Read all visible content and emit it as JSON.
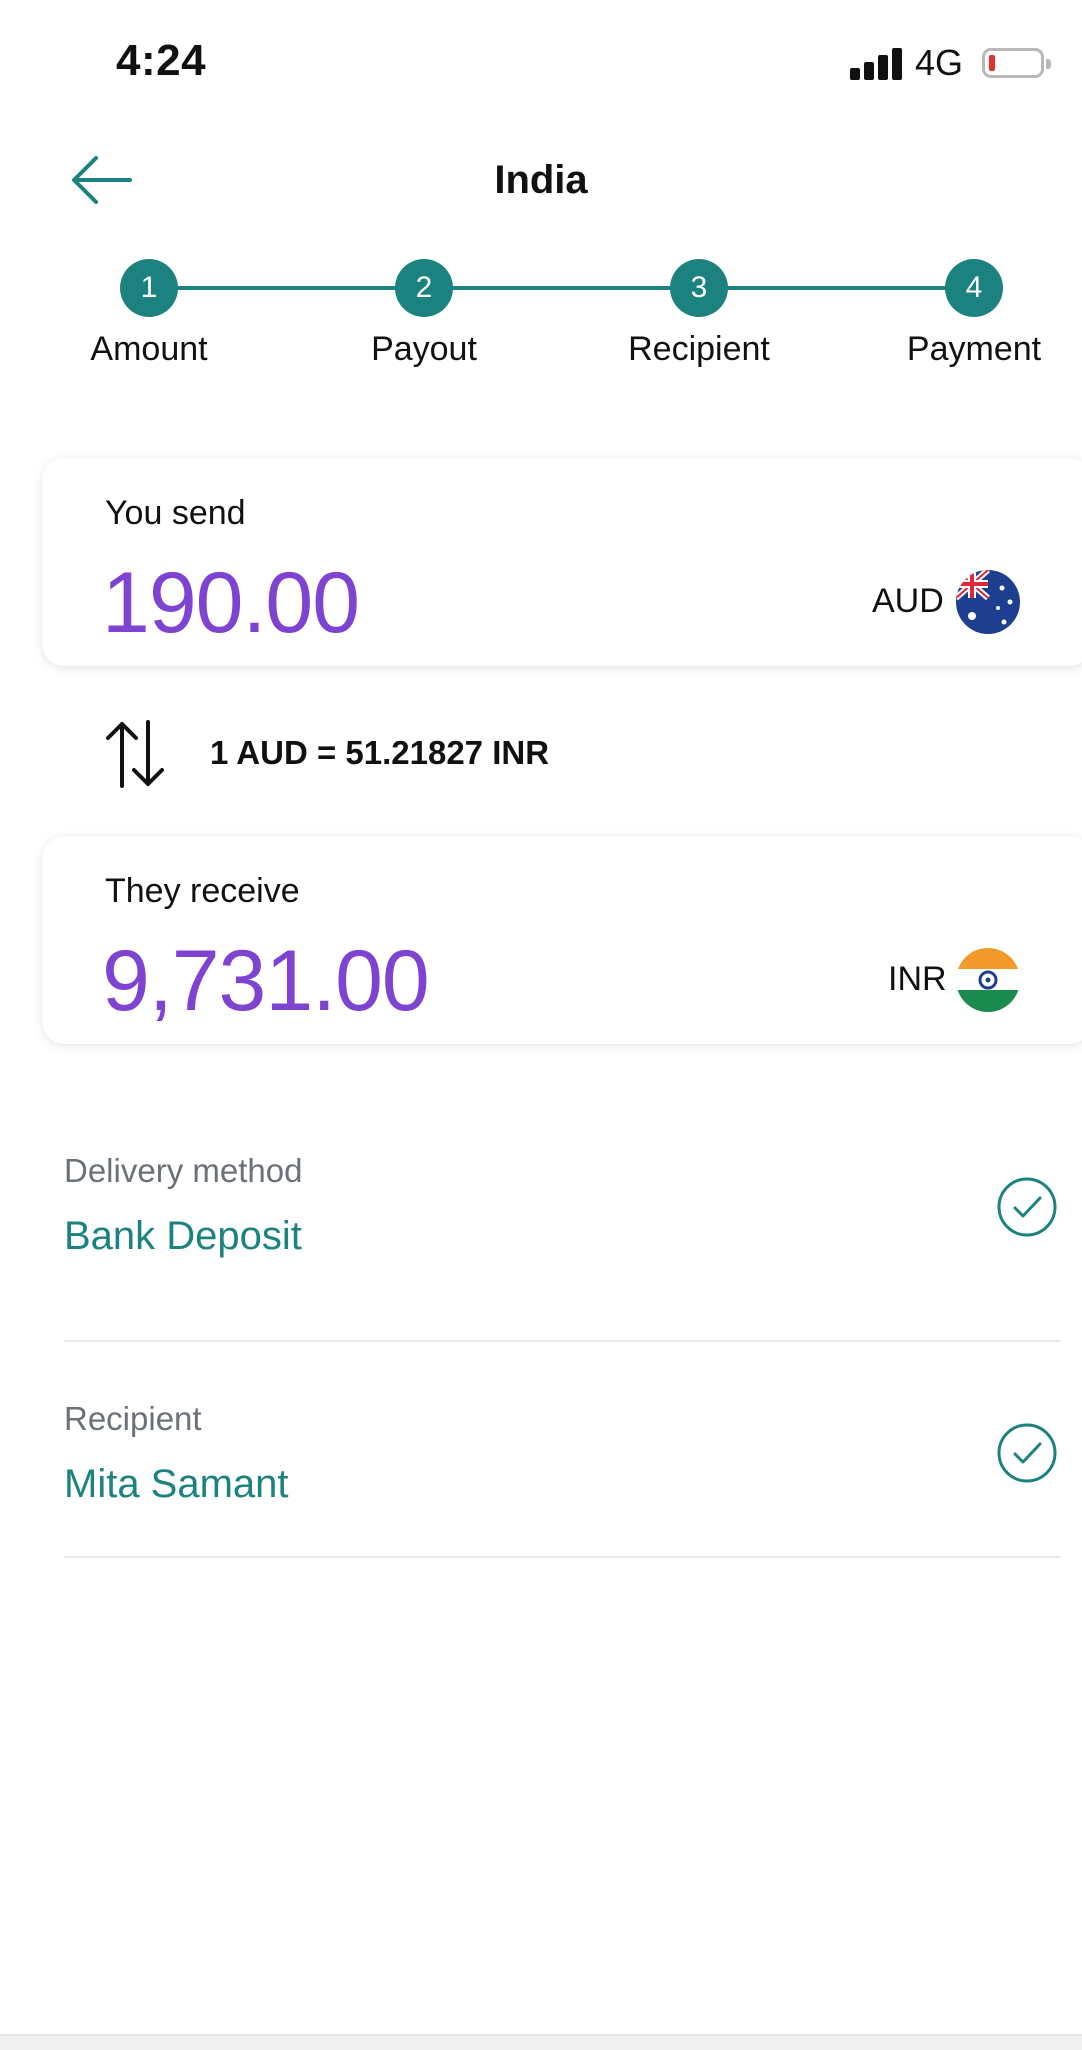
{
  "status_bar": {
    "time": "4:24",
    "network": "4G",
    "battery_level": 0.1
  },
  "header": {
    "back_icon": "arrow-left-icon",
    "title": "India"
  },
  "stepper": {
    "steps": [
      {
        "number": "1",
        "label": "Amount"
      },
      {
        "number": "2",
        "label": "Payout"
      },
      {
        "number": "3",
        "label": "Recipient"
      },
      {
        "number": "4",
        "label": "Payment"
      }
    ]
  },
  "send": {
    "label": "You send",
    "amount": "190.00",
    "currency": "AUD",
    "flag": "australia-flag-icon"
  },
  "exchange": {
    "icon": "swap-vertical-icon",
    "rate_text": "1 AUD = 51.21827 INR"
  },
  "receive": {
    "label": "They receive",
    "amount": "9,731.00",
    "currency": "INR",
    "flag": "india-flag-icon"
  },
  "delivery": {
    "label": "Delivery method",
    "value": "Bank Deposit",
    "status_icon": "check-circle-icon"
  },
  "recipient": {
    "label": "Recipient",
    "value": "Mita Samant",
    "status_icon": "check-circle-icon"
  },
  "colors": {
    "accent": "#1b8280",
    "amount": "#7e43d1",
    "muted": "#6b7178"
  }
}
